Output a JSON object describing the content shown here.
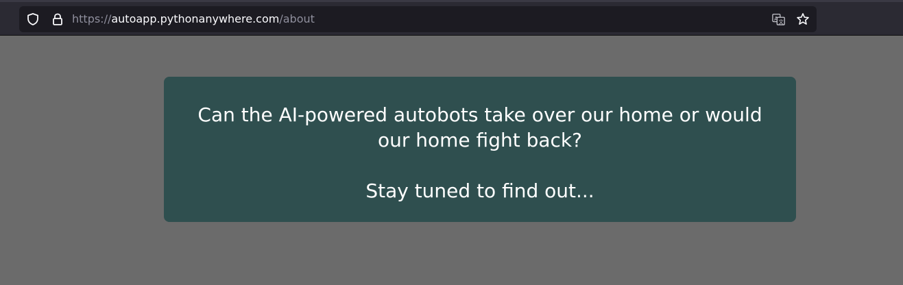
{
  "browser": {
    "url": {
      "scheme": "https://",
      "host": "autoapp.pythonanywhere.com",
      "path": "/about"
    },
    "icons": {
      "tracking": "shield-icon",
      "security": "lock-icon",
      "translate": "translate-icon",
      "bookmark": "star-icon"
    }
  },
  "page": {
    "message": "Can the AI-powered autobots take over our home or would our home fight back?",
    "tagline": "Stay tuned to find out..."
  },
  "colors": {
    "page_background": "#6b6b6b",
    "card_background": "#2f4f4f",
    "card_text": "#ffffff",
    "toolbar": "#2b2a33",
    "urlbar": "#1c1b22"
  }
}
